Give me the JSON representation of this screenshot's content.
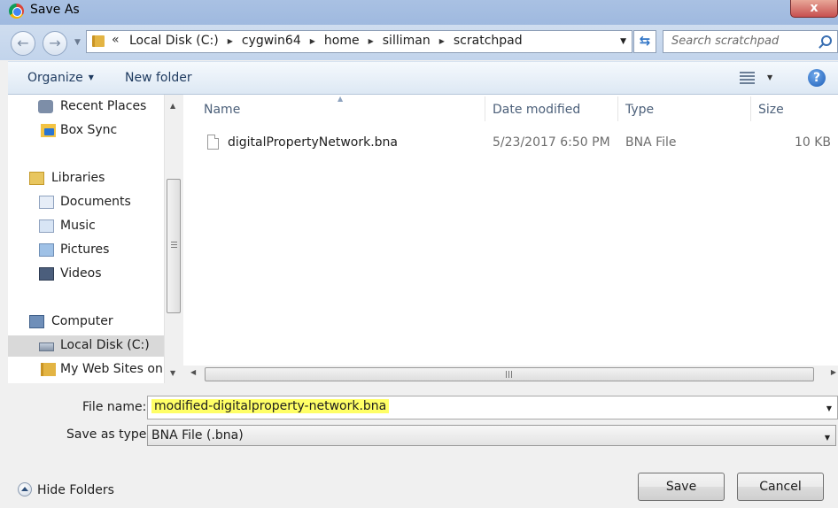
{
  "window": {
    "title": "Save As",
    "close_label": "x"
  },
  "nav": {
    "back_glyph": "←",
    "forward_glyph": "→",
    "breadcrumbs": [
      "Local Disk (C:)",
      "cygwin64",
      "home",
      "silliman",
      "scratchpad"
    ],
    "search_placeholder": "Search scratchpad"
  },
  "toolbar": {
    "organize_label": "Organize",
    "new_folder_label": "New folder",
    "help_label": "?"
  },
  "sidebar": {
    "items": [
      {
        "label": "Recent Places",
        "icon": "recent-places-icon"
      },
      {
        "label": "Box Sync",
        "icon": "box-sync-icon"
      },
      {
        "label": "Libraries",
        "icon": "libraries-icon"
      },
      {
        "label": "Documents",
        "icon": "documents-icon"
      },
      {
        "label": "Music",
        "icon": "music-icon"
      },
      {
        "label": "Pictures",
        "icon": "pictures-icon"
      },
      {
        "label": "Videos",
        "icon": "videos-icon"
      },
      {
        "label": "Computer",
        "icon": "computer-icon"
      },
      {
        "label": "Local Disk (C:)",
        "icon": "local-disk-icon",
        "selected": true
      },
      {
        "label": "My Web Sites on",
        "icon": "web-folder-icon"
      }
    ]
  },
  "files": {
    "columns": [
      "Name",
      "Date modified",
      "Type",
      "Size"
    ],
    "rows": [
      {
        "name": "digitalPropertyNetwork.bna",
        "date": "5/23/2017 6:50 PM",
        "type": "BNA File",
        "size": "10 KB"
      }
    ]
  },
  "form": {
    "filename_label": "File name:",
    "filename_value": "modified-digitalproperty-network.bna",
    "savetype_label": "Save as type:",
    "savetype_value": "BNA File (.bna)"
  },
  "footer": {
    "hide_folders_label": "Hide Folders",
    "save_label": "Save",
    "cancel_label": "Cancel"
  },
  "colors": {
    "titlebar": "#a9c1e3",
    "highlight": "#ffff66",
    "help_blue": "#1f5fb8"
  }
}
